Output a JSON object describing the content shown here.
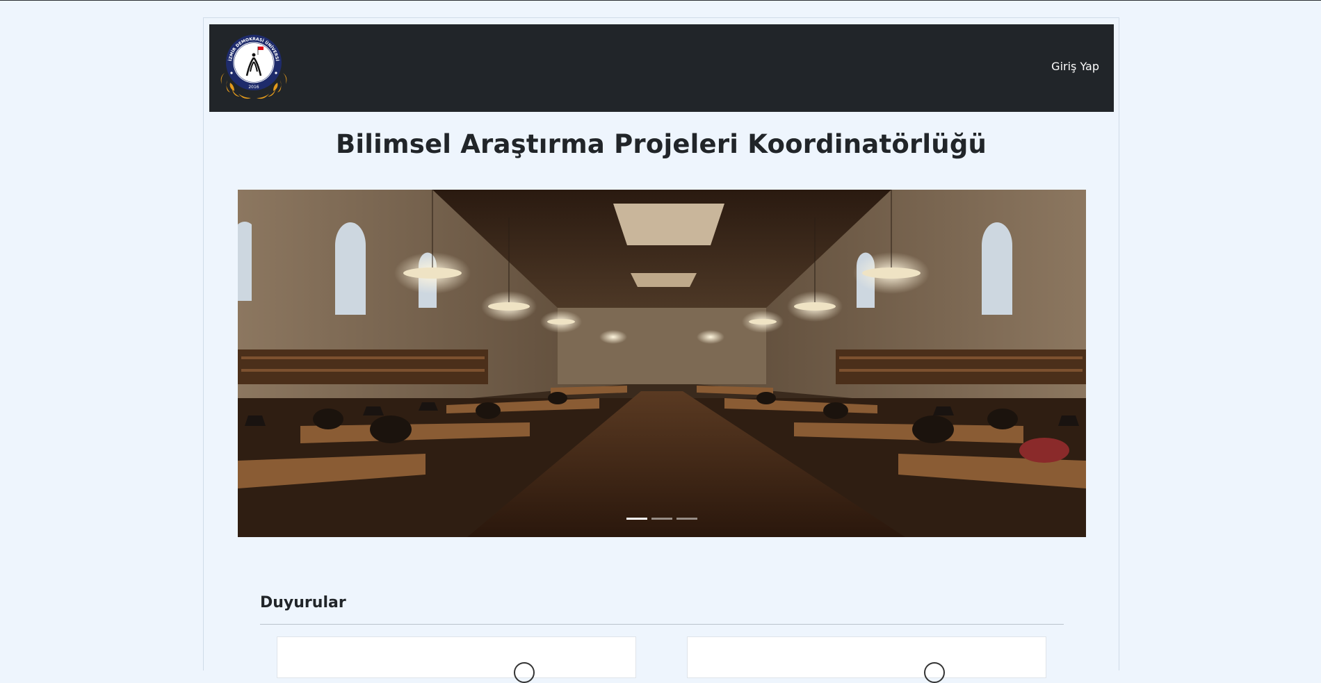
{
  "navbar": {
    "logo_text_top": "İZMİR DEMOKRASİ ÜNİVERSİTESİ",
    "logo_year": "2016",
    "login_label": "Giriş Yap"
  },
  "page": {
    "title": "Bilimsel Araştırma Projeleri Koordinatörlüğü"
  },
  "carousel": {
    "slide_count": 3,
    "active_index": 0
  },
  "announcements": {
    "title": "Duyurular"
  },
  "colors": {
    "navbar_bg": "#212529",
    "page_bg": "#eef5fd"
  }
}
